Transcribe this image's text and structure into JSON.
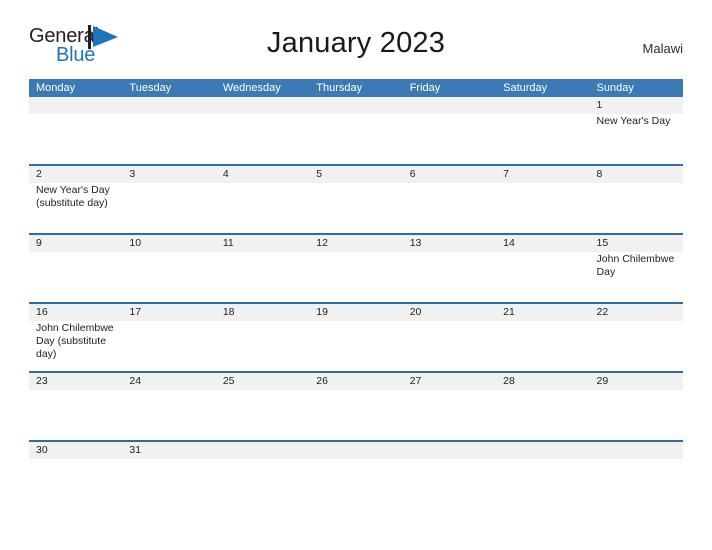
{
  "brand": {
    "word_one": "General",
    "word_two": "Blue",
    "flag_icon": "blue-triangle-flag-icon",
    "color_dark": "#231f20",
    "color_blue": "#1b75bb"
  },
  "header": {
    "title": "January 2023",
    "country": "Malawi"
  },
  "theme": {
    "header_blue": "#3b7ab5",
    "rule_blue": "#2e6da4",
    "date_band_gray": "#f1f1f1"
  },
  "calendar": {
    "weekdays": [
      "Monday",
      "Tuesday",
      "Wednesday",
      "Thursday",
      "Friday",
      "Saturday",
      "Sunday"
    ],
    "weeks": [
      {
        "height": "normal",
        "days": [
          {
            "num": "",
            "events": ""
          },
          {
            "num": "",
            "events": ""
          },
          {
            "num": "",
            "events": ""
          },
          {
            "num": "",
            "events": ""
          },
          {
            "num": "",
            "events": ""
          },
          {
            "num": "",
            "events": ""
          },
          {
            "num": "1",
            "events": "New Year's Day"
          }
        ]
      },
      {
        "height": "normal",
        "days": [
          {
            "num": "2",
            "events": "New Year's Day (substitute day)"
          },
          {
            "num": "3",
            "events": ""
          },
          {
            "num": "4",
            "events": ""
          },
          {
            "num": "5",
            "events": ""
          },
          {
            "num": "6",
            "events": ""
          },
          {
            "num": "7",
            "events": ""
          },
          {
            "num": "8",
            "events": ""
          }
        ]
      },
      {
        "height": "normal",
        "days": [
          {
            "num": "9",
            "events": ""
          },
          {
            "num": "10",
            "events": ""
          },
          {
            "num": "11",
            "events": ""
          },
          {
            "num": "12",
            "events": ""
          },
          {
            "num": "13",
            "events": ""
          },
          {
            "num": "14",
            "events": ""
          },
          {
            "num": "15",
            "events": "John Chilembwe Day"
          }
        ]
      },
      {
        "height": "normal",
        "days": [
          {
            "num": "16",
            "events": "John Chilembwe Day (substitute day)"
          },
          {
            "num": "17",
            "events": ""
          },
          {
            "num": "18",
            "events": ""
          },
          {
            "num": "19",
            "events": ""
          },
          {
            "num": "20",
            "events": ""
          },
          {
            "num": "21",
            "events": ""
          },
          {
            "num": "22",
            "events": ""
          }
        ]
      },
      {
        "height": "normal",
        "days": [
          {
            "num": "23",
            "events": ""
          },
          {
            "num": "24",
            "events": ""
          },
          {
            "num": "25",
            "events": ""
          },
          {
            "num": "26",
            "events": ""
          },
          {
            "num": "27",
            "events": ""
          },
          {
            "num": "28",
            "events": ""
          },
          {
            "num": "29",
            "events": ""
          }
        ]
      },
      {
        "height": "short",
        "days": [
          {
            "num": "30",
            "events": ""
          },
          {
            "num": "31",
            "events": ""
          },
          {
            "num": "",
            "events": ""
          },
          {
            "num": "",
            "events": ""
          },
          {
            "num": "",
            "events": ""
          },
          {
            "num": "",
            "events": ""
          },
          {
            "num": "",
            "events": ""
          }
        ]
      }
    ]
  }
}
